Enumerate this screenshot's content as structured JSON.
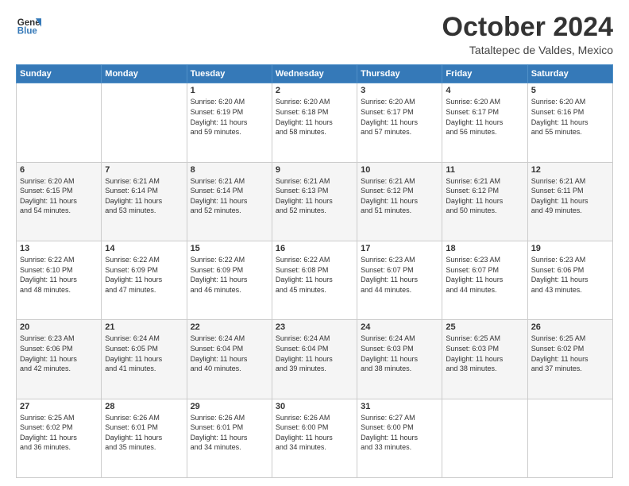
{
  "header": {
    "logo_line1": "General",
    "logo_line2": "Blue",
    "month_title": "October 2024",
    "location": "Tataltepec de Valdes, Mexico"
  },
  "weekdays": [
    "Sunday",
    "Monday",
    "Tuesday",
    "Wednesday",
    "Thursday",
    "Friday",
    "Saturday"
  ],
  "weeks": [
    [
      {
        "day": "",
        "info": ""
      },
      {
        "day": "",
        "info": ""
      },
      {
        "day": "1",
        "info": "Sunrise: 6:20 AM\nSunset: 6:19 PM\nDaylight: 11 hours\nand 59 minutes."
      },
      {
        "day": "2",
        "info": "Sunrise: 6:20 AM\nSunset: 6:18 PM\nDaylight: 11 hours\nand 58 minutes."
      },
      {
        "day": "3",
        "info": "Sunrise: 6:20 AM\nSunset: 6:17 PM\nDaylight: 11 hours\nand 57 minutes."
      },
      {
        "day": "4",
        "info": "Sunrise: 6:20 AM\nSunset: 6:17 PM\nDaylight: 11 hours\nand 56 minutes."
      },
      {
        "day": "5",
        "info": "Sunrise: 6:20 AM\nSunset: 6:16 PM\nDaylight: 11 hours\nand 55 minutes."
      }
    ],
    [
      {
        "day": "6",
        "info": "Sunrise: 6:20 AM\nSunset: 6:15 PM\nDaylight: 11 hours\nand 54 minutes."
      },
      {
        "day": "7",
        "info": "Sunrise: 6:21 AM\nSunset: 6:14 PM\nDaylight: 11 hours\nand 53 minutes."
      },
      {
        "day": "8",
        "info": "Sunrise: 6:21 AM\nSunset: 6:14 PM\nDaylight: 11 hours\nand 52 minutes."
      },
      {
        "day": "9",
        "info": "Sunrise: 6:21 AM\nSunset: 6:13 PM\nDaylight: 11 hours\nand 52 minutes."
      },
      {
        "day": "10",
        "info": "Sunrise: 6:21 AM\nSunset: 6:12 PM\nDaylight: 11 hours\nand 51 minutes."
      },
      {
        "day": "11",
        "info": "Sunrise: 6:21 AM\nSunset: 6:12 PM\nDaylight: 11 hours\nand 50 minutes."
      },
      {
        "day": "12",
        "info": "Sunrise: 6:21 AM\nSunset: 6:11 PM\nDaylight: 11 hours\nand 49 minutes."
      }
    ],
    [
      {
        "day": "13",
        "info": "Sunrise: 6:22 AM\nSunset: 6:10 PM\nDaylight: 11 hours\nand 48 minutes."
      },
      {
        "day": "14",
        "info": "Sunrise: 6:22 AM\nSunset: 6:09 PM\nDaylight: 11 hours\nand 47 minutes."
      },
      {
        "day": "15",
        "info": "Sunrise: 6:22 AM\nSunset: 6:09 PM\nDaylight: 11 hours\nand 46 minutes."
      },
      {
        "day": "16",
        "info": "Sunrise: 6:22 AM\nSunset: 6:08 PM\nDaylight: 11 hours\nand 45 minutes."
      },
      {
        "day": "17",
        "info": "Sunrise: 6:23 AM\nSunset: 6:07 PM\nDaylight: 11 hours\nand 44 minutes."
      },
      {
        "day": "18",
        "info": "Sunrise: 6:23 AM\nSunset: 6:07 PM\nDaylight: 11 hours\nand 44 minutes."
      },
      {
        "day": "19",
        "info": "Sunrise: 6:23 AM\nSunset: 6:06 PM\nDaylight: 11 hours\nand 43 minutes."
      }
    ],
    [
      {
        "day": "20",
        "info": "Sunrise: 6:23 AM\nSunset: 6:06 PM\nDaylight: 11 hours\nand 42 minutes."
      },
      {
        "day": "21",
        "info": "Sunrise: 6:24 AM\nSunset: 6:05 PM\nDaylight: 11 hours\nand 41 minutes."
      },
      {
        "day": "22",
        "info": "Sunrise: 6:24 AM\nSunset: 6:04 PM\nDaylight: 11 hours\nand 40 minutes."
      },
      {
        "day": "23",
        "info": "Sunrise: 6:24 AM\nSunset: 6:04 PM\nDaylight: 11 hours\nand 39 minutes."
      },
      {
        "day": "24",
        "info": "Sunrise: 6:24 AM\nSunset: 6:03 PM\nDaylight: 11 hours\nand 38 minutes."
      },
      {
        "day": "25",
        "info": "Sunrise: 6:25 AM\nSunset: 6:03 PM\nDaylight: 11 hours\nand 38 minutes."
      },
      {
        "day": "26",
        "info": "Sunrise: 6:25 AM\nSunset: 6:02 PM\nDaylight: 11 hours\nand 37 minutes."
      }
    ],
    [
      {
        "day": "27",
        "info": "Sunrise: 6:25 AM\nSunset: 6:02 PM\nDaylight: 11 hours\nand 36 minutes."
      },
      {
        "day": "28",
        "info": "Sunrise: 6:26 AM\nSunset: 6:01 PM\nDaylight: 11 hours\nand 35 minutes."
      },
      {
        "day": "29",
        "info": "Sunrise: 6:26 AM\nSunset: 6:01 PM\nDaylight: 11 hours\nand 34 minutes."
      },
      {
        "day": "30",
        "info": "Sunrise: 6:26 AM\nSunset: 6:00 PM\nDaylight: 11 hours\nand 34 minutes."
      },
      {
        "day": "31",
        "info": "Sunrise: 6:27 AM\nSunset: 6:00 PM\nDaylight: 11 hours\nand 33 minutes."
      },
      {
        "day": "",
        "info": ""
      },
      {
        "day": "",
        "info": ""
      }
    ]
  ]
}
